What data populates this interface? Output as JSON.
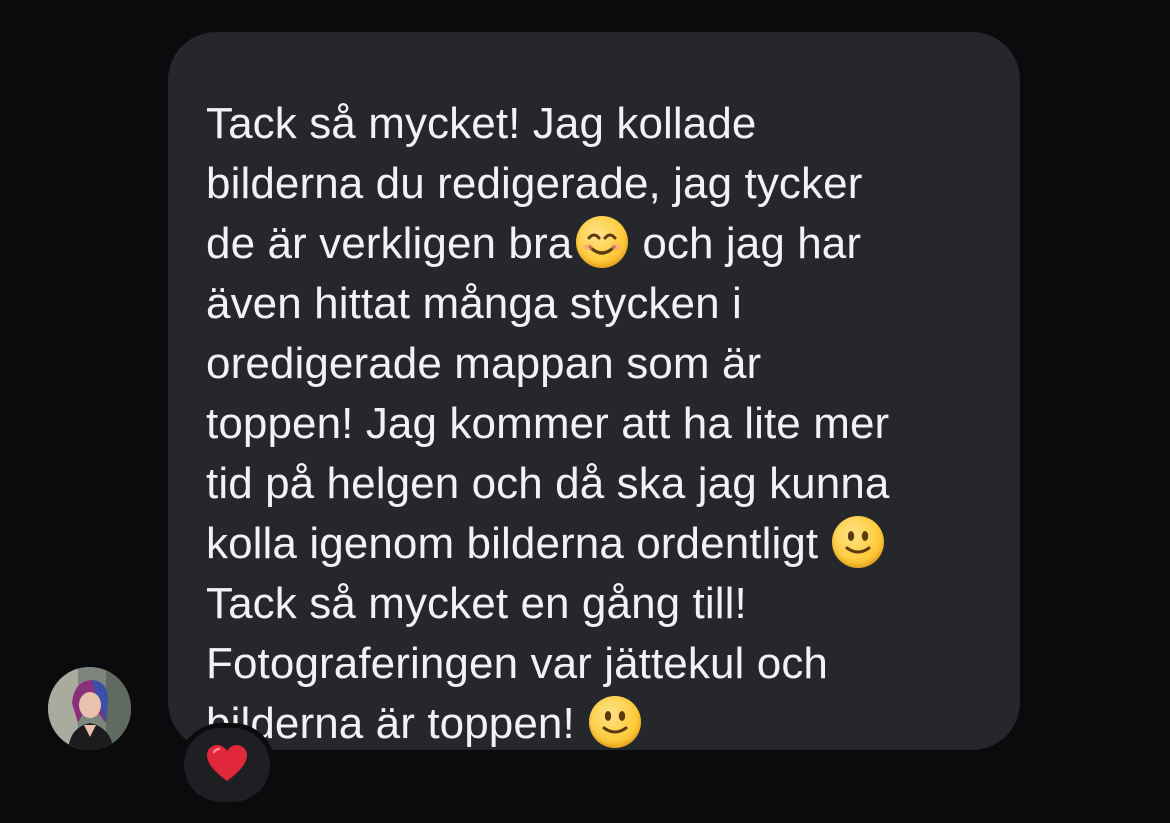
{
  "message": {
    "lines": [
      "Tack så mycket! Jag kollade",
      "bilderna du redigerade, jag tycker",
      "de är verkligen bra",
      "och jag har",
      "även hittat många stycken i",
      "oredigerade mappan som är",
      "toppen! Jag kommer att ha lite mer",
      "tid på helgen och då ska jag kunna",
      "kolla igenom bilderna ordentligt",
      "Tack så mycket en gång till!",
      "Fotograferingen var jättekul och",
      "bilderna är toppen!"
    ]
  },
  "emojis": {
    "smiling_eyes": "smiling-face-with-smiling-eyes",
    "slight_smile": "slightly-smiling-face"
  },
  "reaction": {
    "icon": "red-heart"
  },
  "colors": {
    "background": "#0b0b0d",
    "bubble": "#26272b",
    "text": "#f2f2f4",
    "heart": "#e0283a",
    "emoji": "#ffcc3d"
  }
}
